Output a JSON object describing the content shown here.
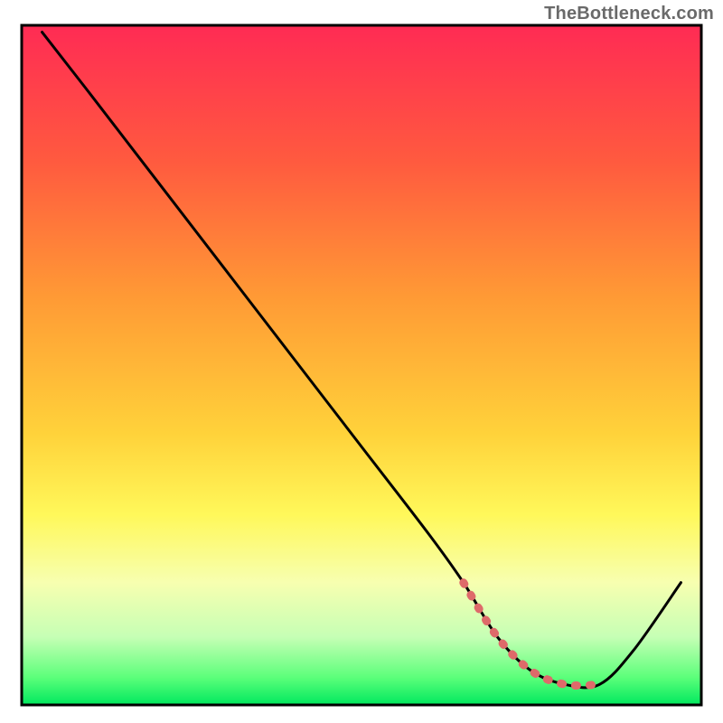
{
  "watermark": "TheBottleneck.com",
  "chart_data": {
    "type": "line",
    "title": "",
    "xlabel": "",
    "ylabel": "",
    "xlim": [
      0,
      100
    ],
    "ylim": [
      0,
      100
    ],
    "x": [
      3,
      10,
      20,
      30,
      40,
      50,
      60,
      65,
      70,
      75,
      80,
      85,
      90,
      97
    ],
    "values": [
      99,
      90,
      77,
      64,
      51,
      38,
      25,
      18,
      10,
      5,
      3,
      3,
      8,
      18
    ],
    "highlight_band_x": [
      65,
      85
    ],
    "gradient_stops": [
      {
        "offset": 0.0,
        "color": "#ff2b54"
      },
      {
        "offset": 0.2,
        "color": "#ff5a3f"
      },
      {
        "offset": 0.4,
        "color": "#ff9a35"
      },
      {
        "offset": 0.6,
        "color": "#ffd23a"
      },
      {
        "offset": 0.72,
        "color": "#fff85a"
      },
      {
        "offset": 0.82,
        "color": "#f7ffb0"
      },
      {
        "offset": 0.9,
        "color": "#c6ffb5"
      },
      {
        "offset": 0.96,
        "color": "#5bff7a"
      },
      {
        "offset": 1.0,
        "color": "#00e85e"
      }
    ],
    "curve_color": "#000000",
    "highlight_color": "#de6a6a",
    "frame_color": "#000000",
    "grid": false,
    "legend": false
  }
}
